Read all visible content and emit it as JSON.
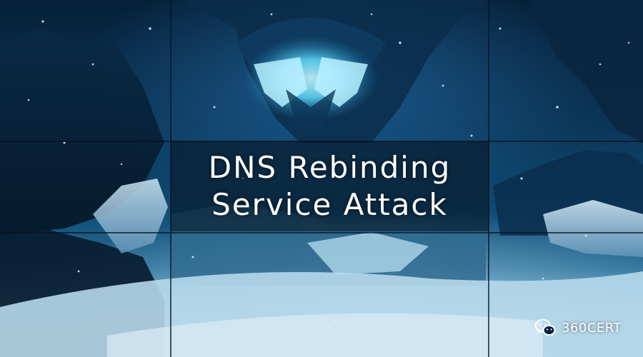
{
  "banner": {
    "title_line_1": "DNS Rebinding",
    "title_line_2": "Service Attack"
  },
  "watermark": {
    "icon": "wechat-icon",
    "label": "360CERT"
  },
  "colors": {
    "sky_dark": "#062038",
    "sky_mid": "#0e4a72",
    "glow": "#7fe6ff",
    "snow": "#a8cde0",
    "title_text": "#ffffff"
  }
}
